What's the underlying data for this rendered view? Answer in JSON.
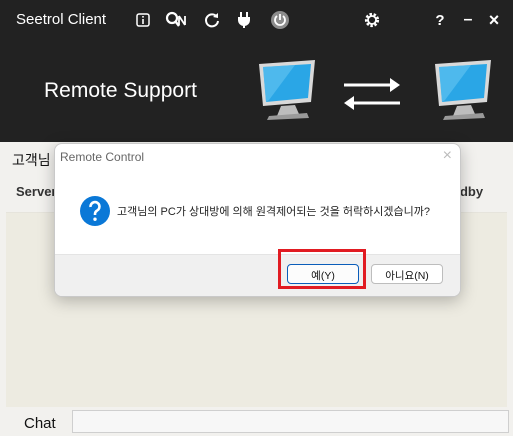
{
  "window": {
    "title": "Seetrol Client",
    "icons": [
      "info-icon",
      "key-search-icon",
      "refresh-icon",
      "plug-icon",
      "power-icon",
      "gear-icon",
      "help-icon",
      "minimize-icon",
      "close-icon"
    ],
    "help_label": "?",
    "minimize_label": "–",
    "close_label": "×"
  },
  "banner": {
    "title": "Remote Support"
  },
  "main": {
    "customer_label": "고객님",
    "server_label": "Server",
    "standby_label": "ndby",
    "chat_label": "Chat",
    "chat_value": ""
  },
  "dialog": {
    "title": "Remote Control",
    "close_label": "×",
    "message": "고객님의 PC가 상대방에 의해 원격제어되는 것을 허락하시겠습니까?",
    "yes_label": "예(Y)",
    "no_label": "아니요(N)"
  },
  "colors": {
    "titlebar": "#222222",
    "accent": "#0a78d7",
    "highlight": "#e11b22",
    "monitor_screen": "#2aa6e6"
  }
}
